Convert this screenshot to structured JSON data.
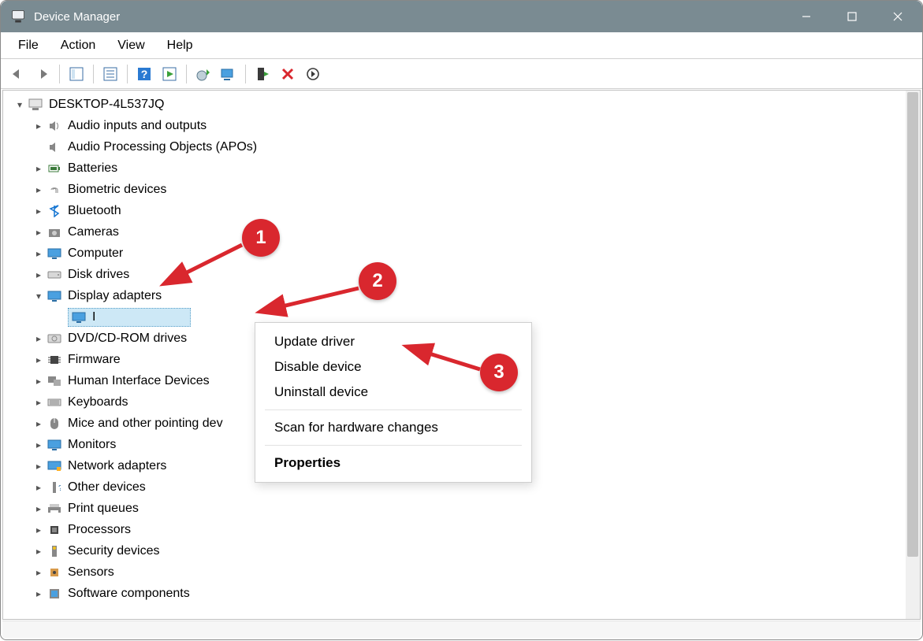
{
  "window": {
    "title": "Device Manager"
  },
  "menus": {
    "file": "File",
    "action": "Action",
    "view": "View",
    "help": "Help"
  },
  "tree": {
    "root": "DESKTOP-4L537JQ",
    "categories": {
      "audio_io": "Audio inputs and outputs",
      "apo": "Audio Processing Objects (APOs)",
      "batteries": "Batteries",
      "biometric": "Biometric devices",
      "bluetooth": "Bluetooth",
      "cameras": "Cameras",
      "computer": "Computer",
      "disk": "Disk drives",
      "display": "Display adapters",
      "display_child": "I",
      "dvd": "DVD/CD-ROM drives",
      "firmware": "Firmware",
      "hid": "Human Interface Devices",
      "keyboards": "Keyboards",
      "mice": "Mice and other pointing dev",
      "monitors": "Monitors",
      "network": "Network adapters",
      "other": "Other devices",
      "print": "Print queues",
      "processors": "Processors",
      "security": "Security devices",
      "sensors": "Sensors",
      "software_comp": "Software components"
    }
  },
  "context_menu": {
    "update": "Update driver",
    "disable": "Disable device",
    "uninstall": "Uninstall device",
    "scan": "Scan for hardware changes",
    "properties": "Properties"
  },
  "annotations": {
    "step1": "1",
    "step2": "2",
    "step3": "3"
  }
}
